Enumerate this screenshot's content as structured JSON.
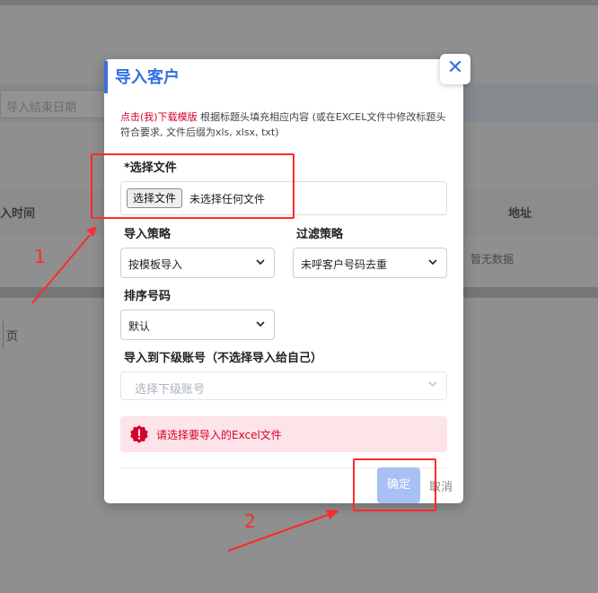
{
  "background": {
    "date_placeholder": "导入结束日期",
    "col_time": "入时间",
    "col_address": "地址",
    "no_data": "暂无数据",
    "page_label": "页"
  },
  "modal": {
    "title": "导入客户",
    "close_symbol": "✕",
    "hint_link": "点击(我)下载模版",
    "hint_text": " 根据标题头填充相应内容 (或在EXCEL文件中修改标题头符合要求, 文件后缀为xls, xlsx, txt)",
    "file_label": "*选择文件",
    "file_button": "选择文件",
    "file_status": "未选择任何文件",
    "import_strategy_label": "导入策略",
    "import_strategy_value": "按模板导入",
    "filter_strategy_label": "过滤策略",
    "filter_strategy_value": "未呼客户号码去重",
    "sort_label": "排序号码",
    "sort_value": "默认",
    "sub_account_label": "导入到下级账号（不选择导入给自己）",
    "sub_account_placeholder": "选择下级账号",
    "alert_text": "请选择要导入的Excel文件",
    "ok_label": "确定",
    "cancel_label": "取消"
  },
  "annotations": {
    "step1": "1",
    "step2": "2",
    "color": "#ff2a2a"
  },
  "icons": {
    "close": "close-icon",
    "chevron": "chevron-down-icon",
    "alert": "error-badge-icon"
  },
  "colors": {
    "accent": "#2f6fe4",
    "error": "#d9002c",
    "error_bg": "#fde4e8",
    "ok_button": "#a9c0f4"
  }
}
